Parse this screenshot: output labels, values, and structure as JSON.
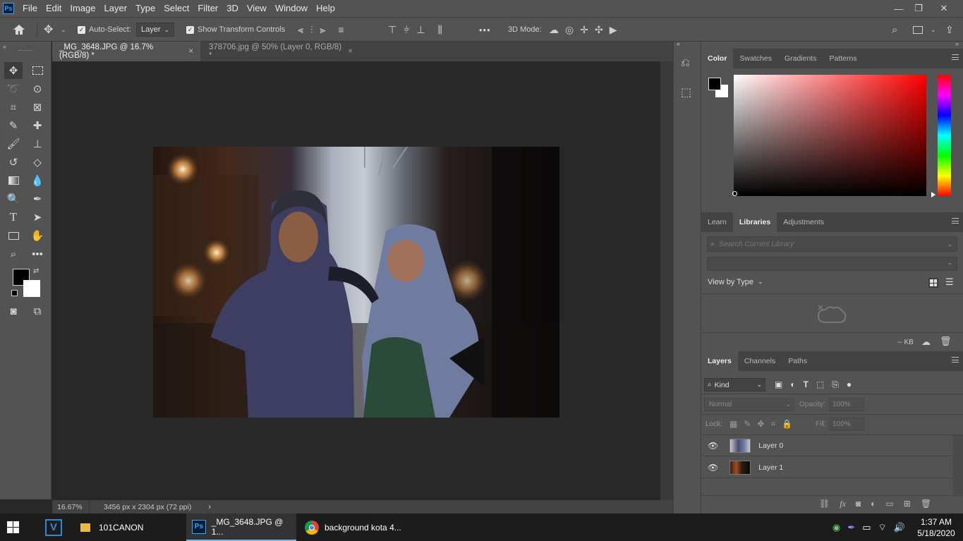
{
  "app": {
    "logo": "Ps"
  },
  "menu": [
    "File",
    "Edit",
    "Image",
    "Layer",
    "Type",
    "Select",
    "Filter",
    "3D",
    "View",
    "Window",
    "Help"
  ],
  "window_controls": {
    "minimize": "—",
    "restore": "❐",
    "close": "✕"
  },
  "options": {
    "auto_select_label": "Auto-Select:",
    "auto_select_value": "Layer",
    "show_transform_label": "Show Transform Controls",
    "more": "•••",
    "mode_3d_label": "3D Mode:"
  },
  "tabs": [
    {
      "label": "_MG_3648.JPG @ 16.7% (RGB/8) *",
      "active": true
    },
    {
      "label": "378706.jpg @ 50% (Layer 0, RGB/8) *",
      "active": false
    }
  ],
  "status": {
    "zoom": "16.67%",
    "doc_info": "3456 px x 2304 px (72 ppi)",
    "arrow": "›"
  },
  "color_panel": {
    "tabs": [
      "Color",
      "Swatches",
      "Gradients",
      "Patterns"
    ]
  },
  "learn_panel": {
    "tabs": [
      "Learn",
      "Libraries",
      "Adjustments"
    ],
    "search_placeholder": "Search Current Library",
    "view_by": "View by Type",
    "size": "-- KB"
  },
  "layers_panel": {
    "tabs": [
      "Layers",
      "Channels",
      "Paths"
    ],
    "kind": "Kind",
    "blend_mode": "Normal",
    "opacity_label": "Opacity:",
    "opacity_value": "100%",
    "lock_label": "Lock:",
    "fill_label": "Fill:",
    "fill_value": "100%",
    "layers": [
      {
        "name": "Layer 0",
        "visible": true
      },
      {
        "name": "Layer 1",
        "visible": true
      }
    ]
  },
  "taskbar": {
    "apps": [
      {
        "label": "",
        "icon": "v-icon"
      },
      {
        "label": "101CANON",
        "icon": "folder-icon"
      },
      {
        "label": "_MG_3648.JPG @ 1...",
        "icon": "photoshop-icon"
      },
      {
        "label": "background kota 4...",
        "icon": "chrome-icon"
      }
    ],
    "time": "1:37 AM",
    "date": "5/18/2020"
  },
  "colors": {
    "accent": "#31a8ff",
    "panel": "#535353",
    "canvas_bg": "#282828"
  }
}
